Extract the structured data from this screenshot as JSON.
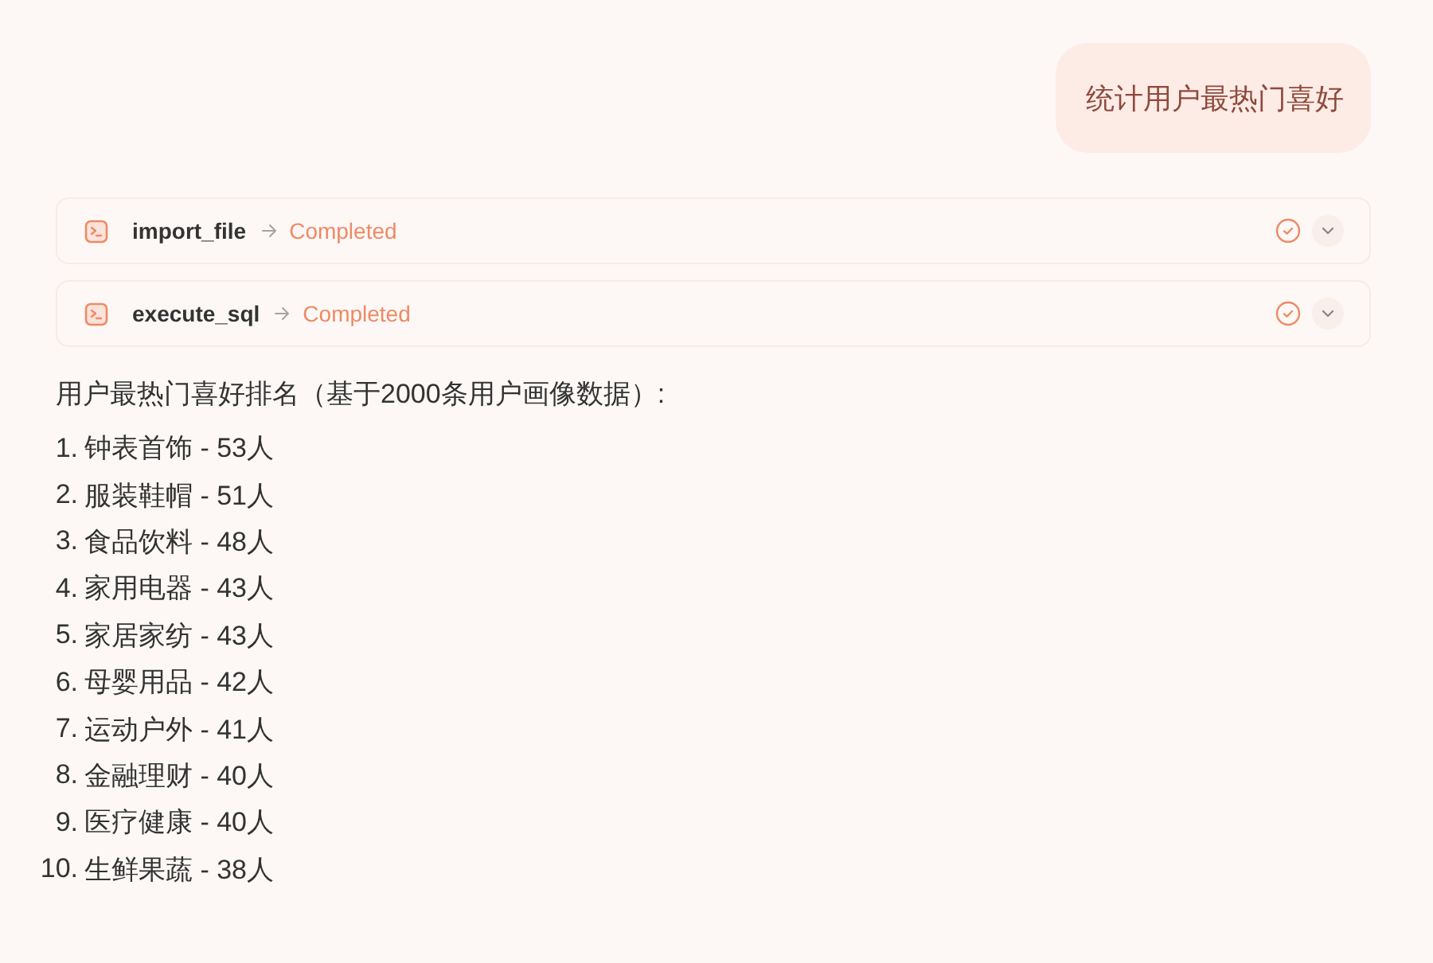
{
  "user_message": {
    "text": "统计用户最热门喜好"
  },
  "tool_calls": [
    {
      "name": "import_file",
      "status": "Completed"
    },
    {
      "name": "execute_sql",
      "status": "Completed"
    }
  ],
  "answer": {
    "heading": "用户最热门喜好排名（基于2000条用户画像数据）:",
    "items": [
      {
        "number": "1.",
        "text": "钟表首饰 - 53人"
      },
      {
        "number": "2.",
        "text": "服装鞋帽 - 51人"
      },
      {
        "number": "3.",
        "text": "食品饮料 - 48人"
      },
      {
        "number": "4.",
        "text": "家用电器 - 43人"
      },
      {
        "number": "5.",
        "text": "家居家纺 - 43人"
      },
      {
        "number": "6.",
        "text": "母婴用品 - 42人"
      },
      {
        "number": "7.",
        "text": "运动户外 - 41人"
      },
      {
        "number": "8.",
        "text": "金融理财 - 40人"
      },
      {
        "number": "9.",
        "text": "医疗健康 - 40人"
      },
      {
        "number": "10.",
        "text": "生鲜果蔬 - 38人"
      }
    ]
  }
}
